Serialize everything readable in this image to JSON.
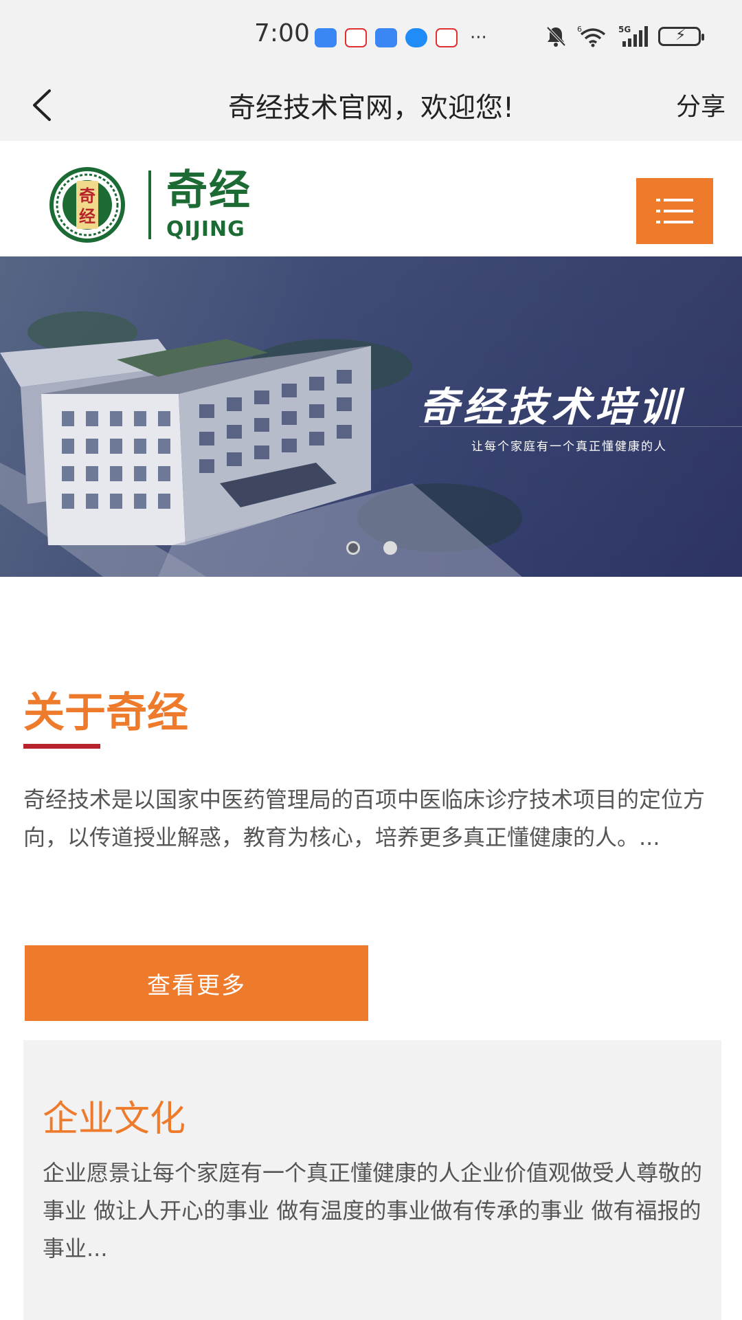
{
  "status_bar": {
    "time": "7:00",
    "notification_icons": [
      "usb-icon",
      "clown-app-icon",
      "blue-app-icon",
      "message-bubble-icon",
      "clown-app-icon"
    ],
    "more": "···",
    "signal_label_6": "6",
    "signal_label_5g": "5G"
  },
  "titlebar": {
    "title": "奇经技术官网，欢迎您!",
    "share": "分享"
  },
  "header": {
    "logo_cn": "奇经",
    "logo_en": "QIJING",
    "seal_text": "奇经",
    "menu_icon": "menu-icon"
  },
  "banner": {
    "title": "奇经技术培训",
    "subtitle": "让每个家庭有一个真正懂健康的人",
    "slides": 2,
    "active_slide": 1
  },
  "about": {
    "title": "关于奇经",
    "text": "奇经技术是以国家中医药管理局的百项中医临床诊疗技术项目的定位方向，以传道授业解惑，教育为核心，培养更多真正懂健康的人。...",
    "more_button": "查看更多"
  },
  "culture": {
    "title": "企业文化",
    "text": "企业愿景让每个家庭有一个真正懂健康的人企业价值观做受人尊敬的事业 做让人开心的事业 做有温度的事业做有传承的事业 做有福报的事业..."
  },
  "colors": {
    "accent_orange": "#ee7a2c",
    "brand_green": "#1c6b35",
    "underline_red": "#b7232a",
    "banner_navy": "#252b5d"
  }
}
